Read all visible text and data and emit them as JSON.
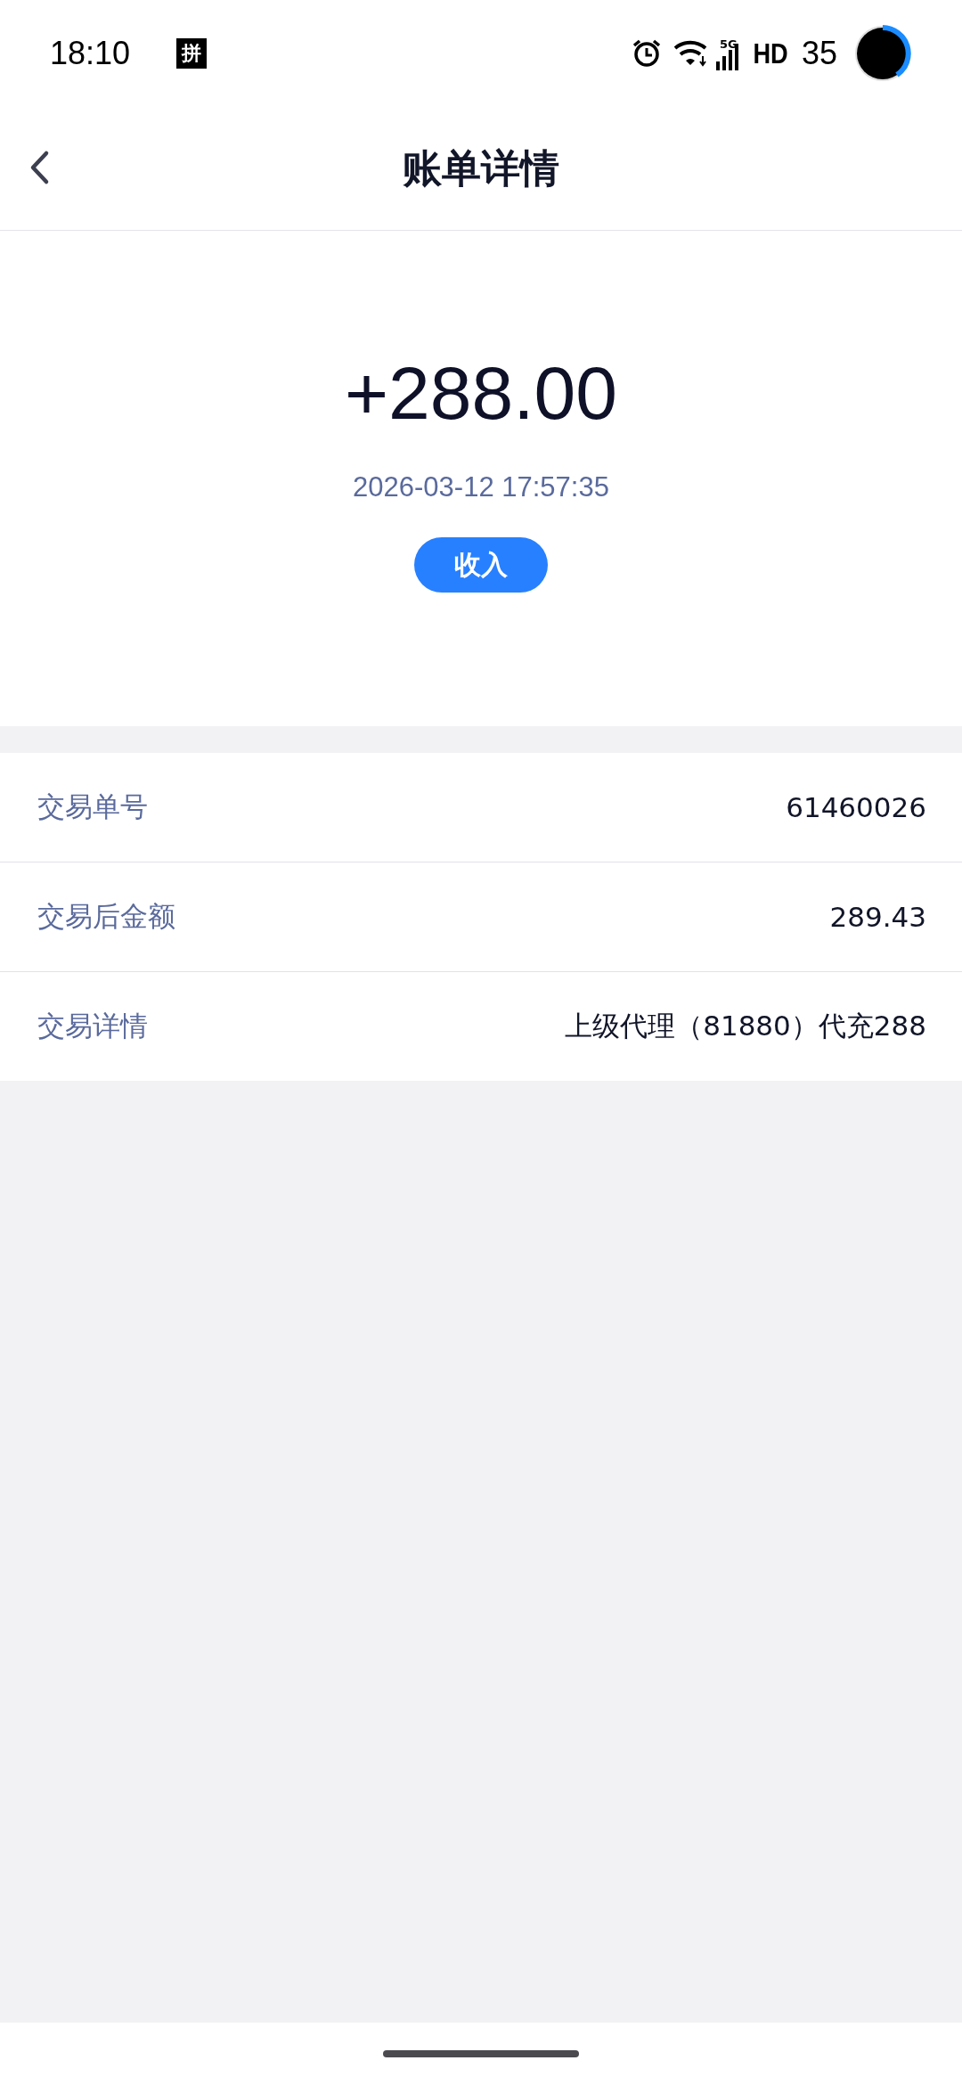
{
  "status_bar": {
    "time": "18:10",
    "input_method": "拼",
    "network": "5G",
    "hd": "HD",
    "battery": "35"
  },
  "header": {
    "title": "账单详情"
  },
  "summary": {
    "amount": "+288.00",
    "datetime": "2026-03-12 17:57:35",
    "type_badge": "收入"
  },
  "details": [
    {
      "label": "交易单号",
      "value": "61460026"
    },
    {
      "label": "交易后金额",
      "value": "289.43"
    },
    {
      "label": "交易详情",
      "value": "上级代理（81880）代充288"
    }
  ]
}
